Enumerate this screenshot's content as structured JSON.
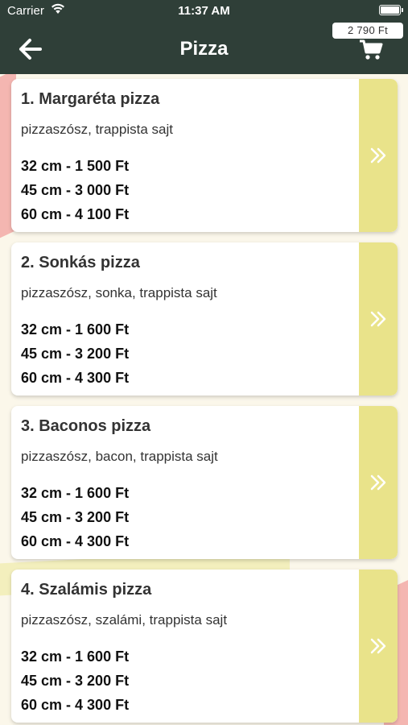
{
  "status_bar": {
    "carrier": "Carrier",
    "time": "11:37 AM"
  },
  "header": {
    "title": "Pizza",
    "cart_total": "2 790 Ft"
  },
  "pizzas": [
    {
      "name": "1. Margaréta pizza",
      "toppings": "pizzaszósz, trappista sajt",
      "prices": [
        "32 cm - 1 500 Ft",
        "45 cm - 3 000 Ft",
        "60 cm - 4 100 Ft"
      ]
    },
    {
      "name": "2. Sonkás pizza",
      "toppings": "pizzaszósz, sonka, trappista sajt",
      "prices": [
        "32 cm - 1 600 Ft",
        "45 cm - 3 200 Ft",
        "60 cm - 4 300 Ft"
      ]
    },
    {
      "name": "3. Baconos pizza",
      "toppings": "pizzaszósz, bacon, trappista sajt",
      "prices": [
        "32 cm - 1 600 Ft",
        "45 cm - 3 200 Ft",
        "60 cm - 4 300 Ft"
      ]
    },
    {
      "name": "4. Szalámis pizza",
      "toppings": "pizzaszósz, szalámi, trappista sajt",
      "prices": [
        "32 cm - 1 600 Ft",
        "45 cm - 3 200 Ft",
        "60 cm - 4 300 Ft"
      ]
    }
  ],
  "icons": {
    "back": "arrow-left-icon",
    "cart": "shopping-cart-icon",
    "open_item": "double-chevron-right-icon"
  },
  "colors": {
    "header_bg": "#2f3f38",
    "accent_yellow": "#e9e38a",
    "deco_pink": "#f4b6b1"
  }
}
